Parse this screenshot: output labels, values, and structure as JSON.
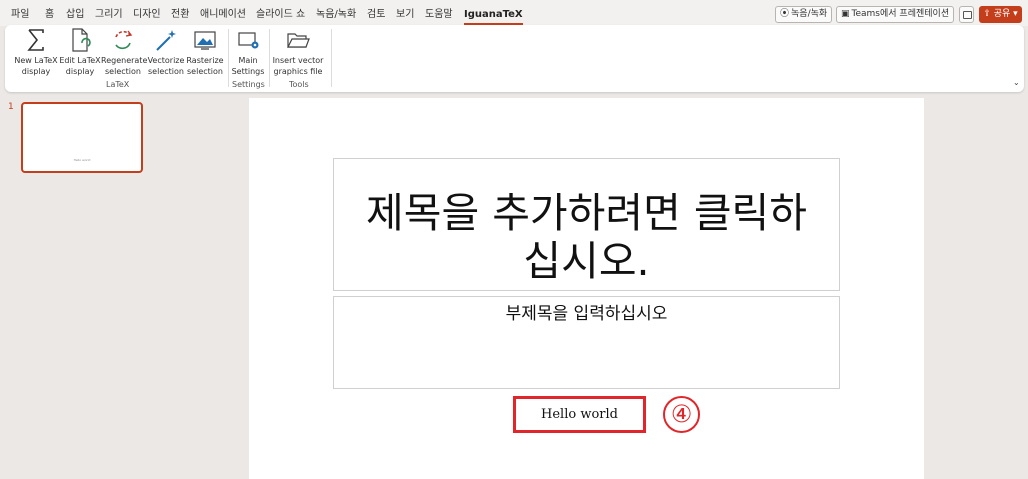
{
  "menu": {
    "tabs": [
      "파일",
      "홈",
      "삽입",
      "그리기",
      "디자인",
      "전환",
      "애니메이션",
      "슬라이드 쇼",
      "녹음/녹화",
      "검토",
      "보기",
      "도움말",
      "IguanaTeX"
    ],
    "active_tab": "IguanaTeX",
    "record_button": "녹음/녹화",
    "teams_button": "Teams에서 프레젠테이션",
    "share_button": "공유"
  },
  "ribbon": {
    "latex_group": {
      "label": "LaTeX",
      "new_display": [
        "New LaTeX",
        "display"
      ],
      "edit_display": [
        "Edit LaTeX",
        "display"
      ],
      "regenerate": [
        "Regenerate",
        "selection"
      ],
      "vectorize": [
        "Vectorize",
        "selection"
      ],
      "rasterize": [
        "Rasterize",
        "selection"
      ]
    },
    "settings_group": {
      "label": "Settings",
      "main_settings": [
        "Main",
        "Settings"
      ]
    },
    "tools_group": {
      "label": "Tools",
      "insert_vector": [
        "Insert vector",
        "graphics file"
      ]
    }
  },
  "thumbnails": [
    {
      "number": "1",
      "text": "Hello world"
    }
  ],
  "slide": {
    "title_placeholder_line1": "제목을 추가하려면 클릭하",
    "title_placeholder_line2": "십시오.",
    "subtitle_placeholder": "부제목을 입력하십시오",
    "hello_text": "Hello world",
    "marker": "④"
  },
  "colors": {
    "accent": "#c43e1c",
    "highlight_red": "#e0262a"
  }
}
